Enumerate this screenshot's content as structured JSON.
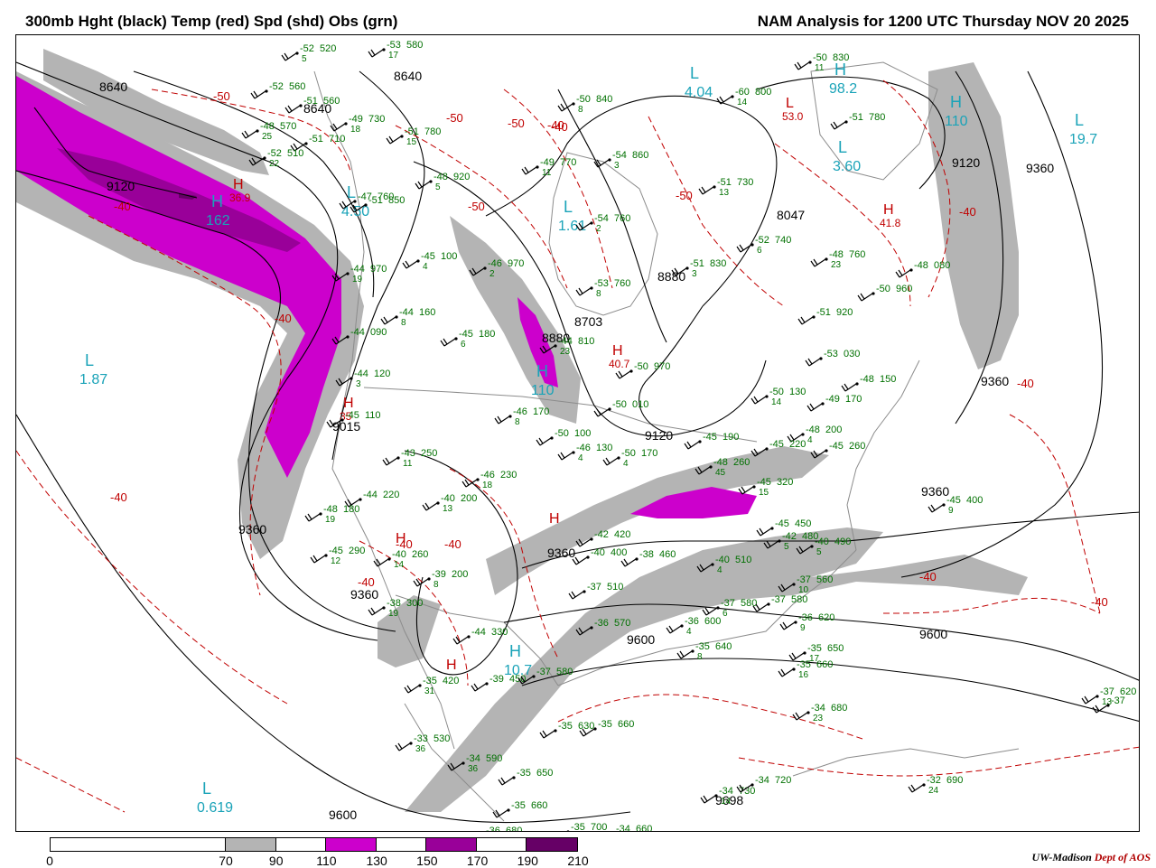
{
  "header": {
    "title_left": "300mb Hght (black) Temp (red) Spd (shd) Obs (grn)",
    "title_right": "NAM Analysis for 1200 UTC Thursday  NOV 20 2025"
  },
  "colors": {
    "height": "#000000",
    "temp": "#c00000",
    "obs": "#007000",
    "station": "#000000",
    "hilo_speed": "#1aa3b8",
    "geography": "#8c8c8c",
    "shade_70": "#b4b4b4",
    "shade_110": "#cc00cc",
    "shade_150": "#990099",
    "shade_190": "#660066"
  },
  "colorbar": {
    "labels": [
      "0",
      "70",
      "90",
      "110",
      "130",
      "150",
      "170",
      "190",
      "210"
    ],
    "segments": [
      {
        "from": 0,
        "to": 70,
        "color": "#ffffff"
      },
      {
        "from": 70,
        "to": 90,
        "color": "#b4b4b4"
      },
      {
        "from": 90,
        "to": 110,
        "color": "#ffffff"
      },
      {
        "from": 110,
        "to": 130,
        "color": "#cc00cc"
      },
      {
        "from": 130,
        "to": 150,
        "color": "#ffffff"
      },
      {
        "from": 150,
        "to": 170,
        "color": "#990099"
      },
      {
        "from": 170,
        "to": 190,
        "color": "#ffffff"
      },
      {
        "from": 190,
        "to": 210,
        "color": "#660066"
      }
    ]
  },
  "credit": {
    "org": "UW-Madison",
    "dept": "Dept of AOS"
  },
  "height_labels": [
    "8640",
    "8640",
    "9120",
    "8640",
    "9120",
    "8047",
    "8880",
    "8703",
    "8880",
    "9360",
    "9120",
    "9015",
    "9360",
    "9360",
    "9360",
    "9600",
    "9600",
    "9600",
    "9360",
    "9360",
    "9698"
  ],
  "temp_labels": [
    "-50",
    "-50",
    "-50",
    "-40",
    "-40",
    "-50",
    "-40",
    "-40",
    "-50",
    "-40",
    "-40",
    "-40",
    "-40",
    "-40",
    "-40",
    "-40",
    "-40"
  ],
  "temp_extrema": [
    {
      "type": "H",
      "value": "36.9"
    },
    {
      "type": "H",
      "value": "40.7"
    },
    {
      "type": "H",
      "value": "41.8"
    },
    {
      "type": "L",
      "value": "53.0"
    },
    {
      "type": "H",
      "value": "35"
    },
    {
      "type": "H",
      "value": ""
    },
    {
      "type": "H",
      "value": ""
    },
    {
      "type": "H",
      "value": ""
    }
  ],
  "speed_extrema": [
    {
      "type": "L",
      "value": "4.04"
    },
    {
      "type": "H",
      "value": "98.2"
    },
    {
      "type": "H",
      "value": "110"
    },
    {
      "type": "L",
      "value": "19.7"
    },
    {
      "type": "L",
      "value": "3.60"
    },
    {
      "type": "H",
      "value": "162"
    },
    {
      "type": "L",
      "value": "1.87"
    },
    {
      "type": "L",
      "value": "1.61"
    },
    {
      "type": "H",
      "value": "110"
    },
    {
      "type": "L",
      "value": "4.50"
    },
    {
      "type": "H",
      "value": "10.7"
    },
    {
      "type": "L",
      "value": "0.619"
    }
  ],
  "station_obs": [
    {
      "t": "-52",
      "h": "520",
      "d": "5"
    },
    {
      "t": "-53",
      "h": "580",
      "d": "17"
    },
    {
      "t": "-52",
      "h": "560",
      "d": ""
    },
    {
      "t": "-51",
      "h": "560",
      "d": ""
    },
    {
      "t": "-48",
      "h": "570",
      "d": "25"
    },
    {
      "t": "-49",
      "h": "730",
      "d": "18"
    },
    {
      "t": "-51",
      "h": "710",
      "d": ""
    },
    {
      "t": "-52",
      "h": "510",
      "d": "22"
    },
    {
      "t": "-51",
      "h": "780",
      "d": "15"
    },
    {
      "t": "-50",
      "h": "840",
      "d": "8"
    },
    {
      "t": "-60",
      "h": "800",
      "d": "14"
    },
    {
      "t": "-50",
      "h": "830",
      "d": "11"
    },
    {
      "t": "-51",
      "h": "780",
      "d": ""
    },
    {
      "t": "-49",
      "h": "770",
      "d": "11"
    },
    {
      "t": "-54",
      "h": "860",
      "d": "3"
    },
    {
      "t": "-51",
      "h": "730",
      "d": "13"
    },
    {
      "t": "-48",
      "h": "920",
      "d": "5"
    },
    {
      "t": "-47",
      "h": "760",
      "d": ""
    },
    {
      "t": "-51",
      "h": "850",
      "d": ""
    },
    {
      "t": "-54",
      "h": "760",
      "d": "2"
    },
    {
      "t": "-52",
      "h": "740",
      "d": "6"
    },
    {
      "t": "-45",
      "h": "100",
      "d": "4"
    },
    {
      "t": "-46",
      "h": "970",
      "d": "2"
    },
    {
      "t": "-44",
      "h": "970",
      "d": "19"
    },
    {
      "t": "-51",
      "h": "830",
      "d": "3"
    },
    {
      "t": "-48",
      "h": "760",
      "d": "23"
    },
    {
      "t": "-48",
      "h": "080",
      "d": ""
    },
    {
      "t": "-53",
      "h": "760",
      "d": "8"
    },
    {
      "t": "-50",
      "h": "960",
      "d": ""
    },
    {
      "t": "-51",
      "h": "920",
      "d": ""
    },
    {
      "t": "-44",
      "h": "160",
      "d": "8"
    },
    {
      "t": "-45",
      "h": "180",
      "d": "6"
    },
    {
      "t": "-44",
      "h": "090",
      "d": ""
    },
    {
      "t": "-44",
      "h": "810",
      "d": "23"
    },
    {
      "t": "-50",
      "h": "970",
      "d": ""
    },
    {
      "t": "-53",
      "h": "030",
      "d": ""
    },
    {
      "t": "-44",
      "h": "120",
      "d": "3"
    },
    {
      "t": "-48",
      "h": "150",
      "d": ""
    },
    {
      "t": "-50",
      "h": "130",
      "d": "14"
    },
    {
      "t": "-49",
      "h": "170",
      "d": ""
    },
    {
      "t": "-46",
      "h": "170",
      "d": "8"
    },
    {
      "t": "-50",
      "h": "010",
      "d": ""
    },
    {
      "t": "-45",
      "h": "110",
      "d": ""
    },
    {
      "t": "-50",
      "h": "100",
      "d": ""
    },
    {
      "t": "-48",
      "h": "200",
      "d": "4"
    },
    {
      "t": "-43",
      "h": "250",
      "d": "11"
    },
    {
      "t": "-46",
      "h": "130",
      "d": "4"
    },
    {
      "t": "-50",
      "h": "170",
      "d": "4"
    },
    {
      "t": "-45",
      "h": "190",
      "d": ""
    },
    {
      "t": "-45",
      "h": "220",
      "d": ""
    },
    {
      "t": "-45",
      "h": "260",
      "d": ""
    },
    {
      "t": "-46",
      "h": "230",
      "d": "18"
    },
    {
      "t": "-48",
      "h": "260",
      "d": "45"
    },
    {
      "t": "-44",
      "h": "220",
      "d": ""
    },
    {
      "t": "-40",
      "h": "200",
      "d": "13"
    },
    {
      "t": "-45",
      "h": "320",
      "d": "15"
    },
    {
      "t": "-45",
      "h": "400",
      "d": "9"
    },
    {
      "t": "-48",
      "h": "180",
      "d": "19"
    },
    {
      "t": "-42",
      "h": "420",
      "d": ""
    },
    {
      "t": "-45",
      "h": "450",
      "d": ""
    },
    {
      "t": "-45",
      "h": "290",
      "d": "12"
    },
    {
      "t": "-40",
      "h": "260",
      "d": "14"
    },
    {
      "t": "-40",
      "h": "400",
      "d": ""
    },
    {
      "t": "-38",
      "h": "460",
      "d": ""
    },
    {
      "t": "-42",
      "h": "480",
      "d": "5"
    },
    {
      "t": "-40",
      "h": "490",
      "d": "5"
    },
    {
      "t": "-39",
      "h": "200",
      "d": "8"
    },
    {
      "t": "-40",
      "h": "510",
      "d": "4"
    },
    {
      "t": "-37",
      "h": "560",
      "d": "10"
    },
    {
      "t": "-38",
      "h": "300",
      "d": "19"
    },
    {
      "t": "-37",
      "h": "510",
      "d": ""
    },
    {
      "t": "-37",
      "h": "580",
      "d": "6"
    },
    {
      "t": "-37",
      "h": "580",
      "d": ""
    },
    {
      "t": "-36",
      "h": "570",
      "d": ""
    },
    {
      "t": "-36",
      "h": "600",
      "d": "4"
    },
    {
      "t": "-36",
      "h": "620",
      "d": "9"
    },
    {
      "t": "-44",
      "h": "330",
      "d": ""
    },
    {
      "t": "-35",
      "h": "640",
      "d": "8"
    },
    {
      "t": "-35",
      "h": "650",
      "d": "17"
    },
    {
      "t": "-35",
      "h": "420",
      "d": "31"
    },
    {
      "t": "-39",
      "h": "450",
      "d": ""
    },
    {
      "t": "-37",
      "h": "580",
      "d": ""
    },
    {
      "t": "-35",
      "h": "660",
      "d": "16"
    },
    {
      "t": "-37",
      "h": "620",
      "d": "13"
    },
    {
      "t": "-34",
      "h": "680",
      "d": "23"
    },
    {
      "t": "-35",
      "h": "630",
      "d": ""
    },
    {
      "t": "-35",
      "h": "660",
      "d": ""
    },
    {
      "t": "-33",
      "h": "530",
      "d": "36"
    },
    {
      "t": "-34",
      "h": "590",
      "d": "36"
    },
    {
      "t": "-35",
      "h": "650",
      "d": ""
    },
    {
      "t": "-34",
      "h": "730",
      "d": "14"
    },
    {
      "t": "-34",
      "h": "720",
      "d": ""
    },
    {
      "t": "-32",
      "h": "690",
      "d": "24"
    },
    {
      "t": "-35",
      "h": "660",
      "d": ""
    },
    {
      "t": "-36",
      "h": "680",
      "d": ""
    },
    {
      "t": "-35",
      "h": "700",
      "d": ""
    },
    {
      "t": "-34",
      "h": "660",
      "d": ""
    },
    {
      "t": "-37",
      "h": "",
      "d": ""
    }
  ]
}
